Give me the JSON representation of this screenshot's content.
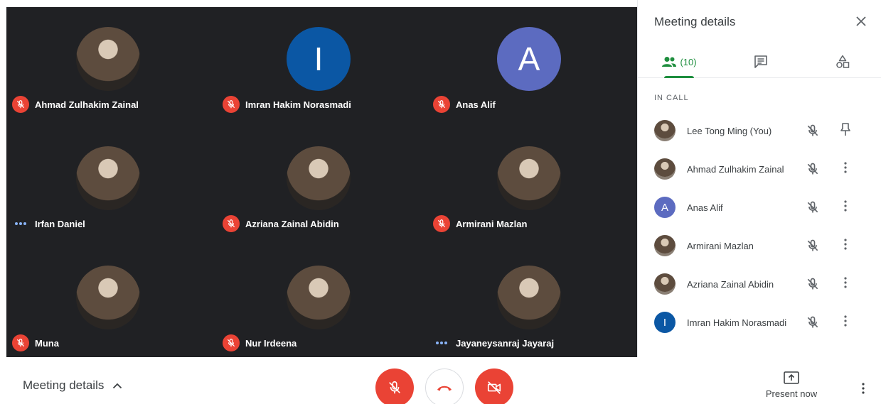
{
  "participants_grid": [
    {
      "name": "Ahmad Zulhakim Zainal",
      "status": "muted",
      "avatar": {
        "type": "photo"
      }
    },
    {
      "name": "Imran Hakim Norasmadi",
      "status": "muted",
      "avatar": {
        "type": "letter",
        "letter": "I",
        "color": "#0b57a4"
      }
    },
    {
      "name": "Anas Alif",
      "status": "muted",
      "avatar": {
        "type": "letter",
        "letter": "A",
        "color": "#5c6bc0"
      }
    },
    {
      "name": "Irfan Daniel",
      "status": "connecting",
      "avatar": {
        "type": "photo"
      }
    },
    {
      "name": "Azriana Zainal Abidin",
      "status": "muted",
      "avatar": {
        "type": "photo"
      }
    },
    {
      "name": "Armirani Mazlan",
      "status": "muted",
      "avatar": {
        "type": "photo"
      }
    },
    {
      "name": "Muna",
      "status": "muted",
      "avatar": {
        "type": "photo"
      }
    },
    {
      "name": "Nur Irdeena",
      "status": "muted",
      "avatar": {
        "type": "photo"
      }
    },
    {
      "name": "Jayaneysanraj Jayaraj",
      "status": "connecting",
      "avatar": {
        "type": "photo"
      }
    }
  ],
  "panel": {
    "title": "Meeting details",
    "people_count": "(10)",
    "section_label": "IN CALL",
    "people": [
      {
        "name": "Lee Tong Ming (You)",
        "avatar": {
          "type": "photo"
        },
        "action_icon": "pin-icon"
      },
      {
        "name": "Ahmad Zulhakim Zainal",
        "avatar": {
          "type": "photo"
        },
        "action_icon": "more-vert-icon"
      },
      {
        "name": "Anas Alif",
        "avatar": {
          "type": "letter",
          "letter": "A",
          "color": "#5c6bc0"
        },
        "action_icon": "more-vert-icon"
      },
      {
        "name": "Armirani Mazlan",
        "avatar": {
          "type": "photo"
        },
        "action_icon": "more-vert-icon"
      },
      {
        "name": "Azriana Zainal Abidin",
        "avatar": {
          "type": "photo"
        },
        "action_icon": "more-vert-icon"
      },
      {
        "name": "Imran Hakim Norasmadi",
        "avatar": {
          "type": "letter",
          "letter": "I",
          "color": "#0b57a4"
        },
        "action_icon": "more-vert-icon"
      }
    ]
  },
  "bottom_bar": {
    "meeting_details_label": "Meeting details",
    "present_now_label": "Present now"
  },
  "colors": {
    "grid_bg": "#202124",
    "danger": "#ea4335",
    "accent_green": "#1e8e3e"
  }
}
